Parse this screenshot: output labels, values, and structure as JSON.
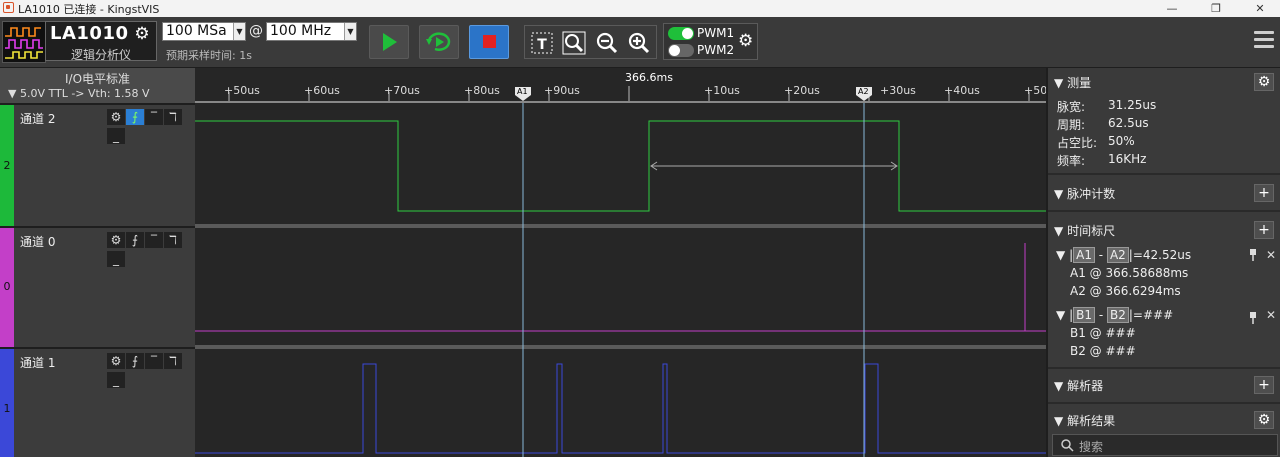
{
  "window": {
    "title": "LA1010 已连接 - KingstVIS",
    "minimize": "—",
    "restore": "❐",
    "close": "✕"
  },
  "toolbar": {
    "device_name": "LA1010",
    "device_subtitle": "逻辑分析仪",
    "sample_rate": "100 MSa",
    "at": "@",
    "frequency": "100 MHz",
    "pretime_label": "预期采样时间: 1s",
    "pwm1": "PWM1",
    "pwm2": "PWM2",
    "pwm1_on": true,
    "pwm2_on": false,
    "colors": {
      "start": "#1fbf3a",
      "stop": "#e22222",
      "stop_bg": "#2b74c8"
    }
  },
  "left": {
    "io_label": "I/O电平标准",
    "voltage": "▼ 5.0V TTL -> Vth: 1.58 V"
  },
  "channels": [
    {
      "name": "通道 2",
      "number": "2",
      "color": "#1db93a"
    },
    {
      "name": "通道 0",
      "number": "0",
      "color": "#c33fc8"
    },
    {
      "name": "通道 1",
      "number": "1",
      "color": "#3b48d8"
    }
  ],
  "ruler": {
    "center_time": "366.6ms",
    "ticks": [
      "+50us",
      "+60us",
      "+70us",
      "+80us",
      "+90us",
      "+10us",
      "+20us",
      "+30us",
      "+40us",
      "+50"
    ],
    "cursors": [
      "A1",
      "A2"
    ]
  },
  "right": {
    "measure_title": "测量",
    "measurements": [
      {
        "k": "脉宽:",
        "v": "31.25us"
      },
      {
        "k": "周期:",
        "v": "62.5us"
      },
      {
        "k": "占空比:",
        "v": "50%"
      },
      {
        "k": "频率:",
        "v": "16KHz"
      }
    ],
    "pulse_title": "脉冲计数",
    "timescale_title": "时间标尺",
    "a_pair": {
      "left": "A1",
      "right": "A2",
      "prefix": "|",
      "sep": "-",
      "value": "|=42.52us",
      "a1": "A1 @ 366.58688ms",
      "a2": "A2 @ 366.6294ms"
    },
    "b_pair": {
      "left": "B1",
      "right": "B2",
      "prefix": "|",
      "sep": "-",
      "value": "|=###",
      "b1": "B1 @ ###",
      "b2": "B2 @ ###"
    },
    "decoder_title": "解析器",
    "result_title": "解析结果",
    "search_placeholder": "搜索",
    "add": "+",
    "gear": "⚙",
    "expand": "▼",
    "pin": "📍",
    "remove": "✕"
  }
}
